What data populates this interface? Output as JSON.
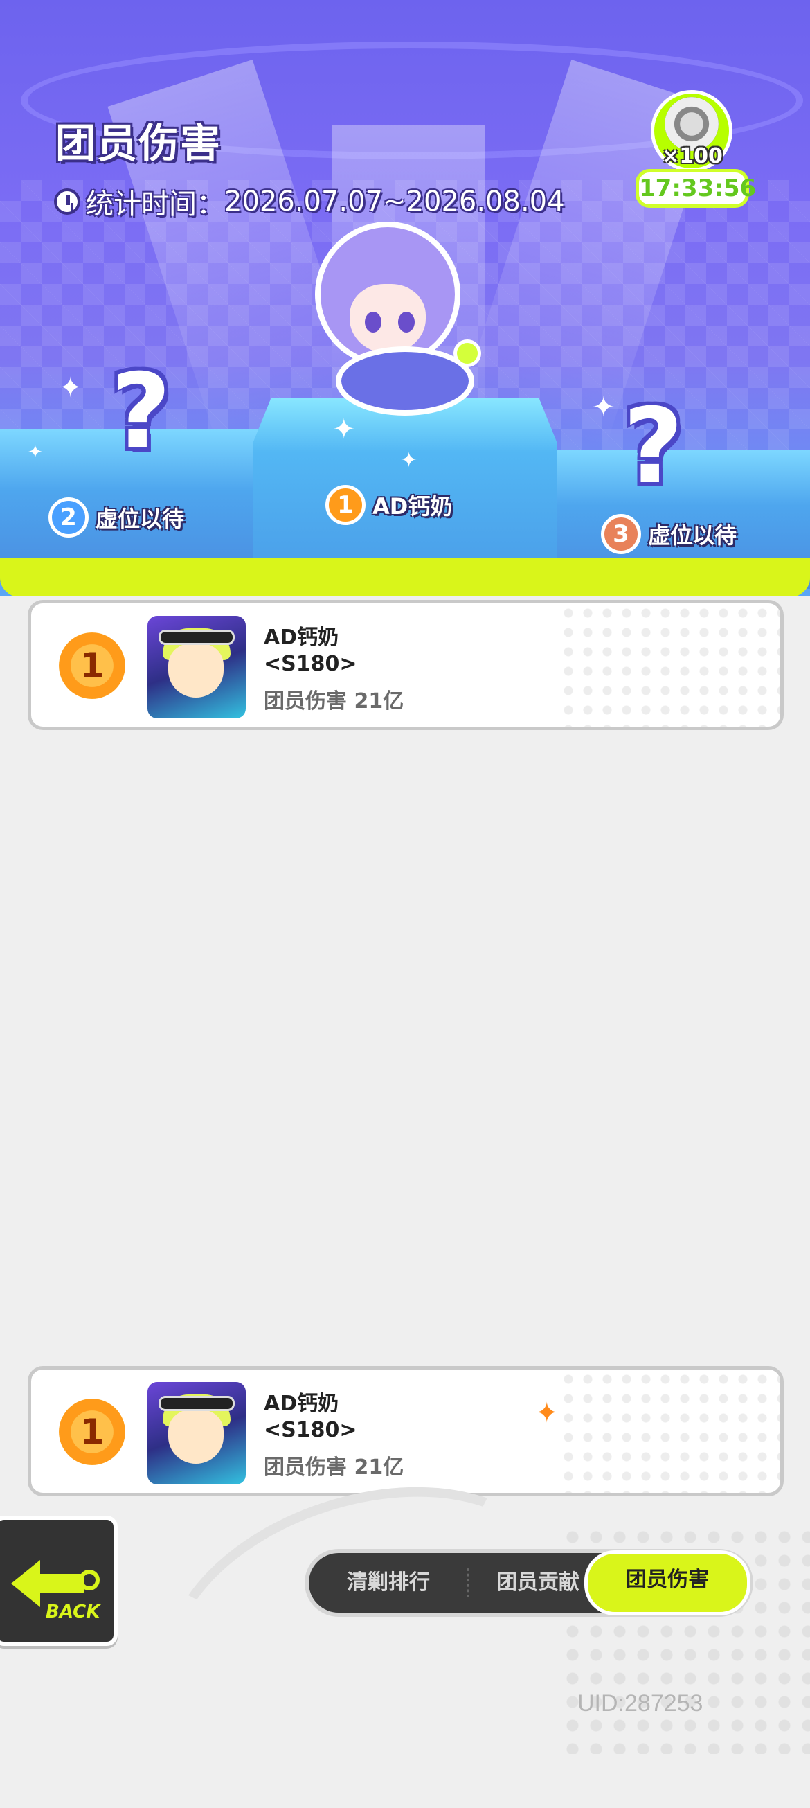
{
  "header": {
    "title": "团员伤害",
    "time_label": "统计时间：",
    "time_range": "2026.07.07~2026.08.04"
  },
  "reward": {
    "count": "×100",
    "timer": "17:33:56"
  },
  "podium": {
    "first": {
      "rank": "1",
      "name": "AD钙奶"
    },
    "second": {
      "rank": "2",
      "name": "虚位以待"
    },
    "third": {
      "rank": "3",
      "name": "虚位以待"
    }
  },
  "ranking_list": [
    {
      "rank": "1",
      "name": "AD钙奶",
      "server": "<S180>",
      "metric": "团员伤害 21亿"
    }
  ],
  "my_rank": {
    "rank": "1",
    "name": "AD钙奶",
    "server": "<S180>",
    "metric": "团员伤害 21亿"
  },
  "back": {
    "label": "BACK"
  },
  "tabs": [
    {
      "label": "清剿排行",
      "active": false
    },
    {
      "label": "团员贡献",
      "active": false
    },
    {
      "label": "团员伤害",
      "active": true
    }
  ],
  "uid": "UID:287253",
  "colors": {
    "accent": "#d9f51a",
    "hero_purple": "#7b6cf4",
    "gold": "#ff9b1a",
    "timer_green": "#64c81e"
  }
}
